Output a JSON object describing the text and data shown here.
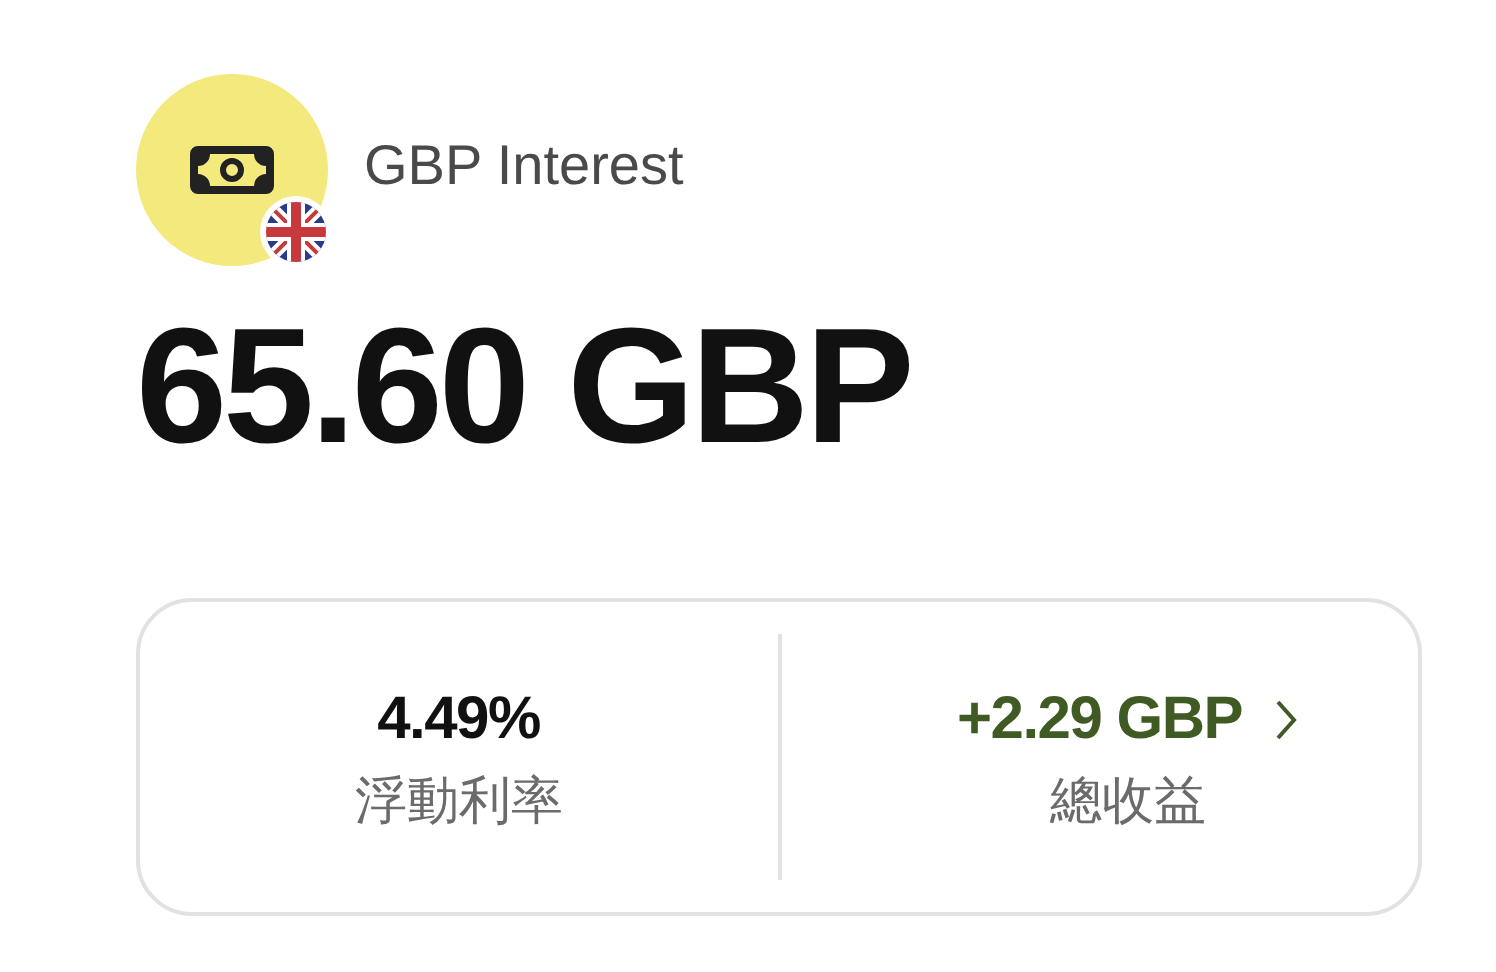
{
  "header": {
    "title": "GBP Interest"
  },
  "balance": "65.60 GBP",
  "stats": [
    {
      "kind": "rate",
      "value": "4.49%",
      "label": "浮動利率"
    },
    {
      "kind": "earnings",
      "value": "+2.29 GBP",
      "label": "總收益"
    }
  ]
}
